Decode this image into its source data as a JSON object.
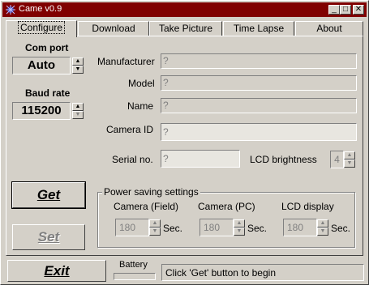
{
  "window": {
    "title": "Came v0.9",
    "controls": {
      "minimize": "_",
      "maximize": "□",
      "close": "✕"
    }
  },
  "tabs": [
    {
      "label": "Configure",
      "active": true
    },
    {
      "label": "Download",
      "active": false
    },
    {
      "label": "Take Picture",
      "active": false
    },
    {
      "label": "Time Lapse",
      "active": false
    },
    {
      "label": "About",
      "active": false
    }
  ],
  "left": {
    "com_port_label": "Com port",
    "com_port_value": "Auto",
    "baud_rate_label": "Baud rate",
    "baud_rate_value": "115200",
    "get_button": "Get",
    "set_button": "Set"
  },
  "info": {
    "manufacturer_label": "Manufacturer",
    "manufacturer_value": "?",
    "model_label": "Model",
    "model_value": "?",
    "name_label": "Name",
    "name_value": "?",
    "camera_id_label": "Camera ID",
    "camera_id_value": "?",
    "serial_label": "Serial no.",
    "serial_value": "?",
    "lcd_brightness_label": "LCD brightness",
    "lcd_brightness_value": "4"
  },
  "power": {
    "group_title": "Power saving settings",
    "field_label": "Camera (Field)",
    "field_value": "180",
    "pc_label": "Camera (PC)",
    "pc_value": "180",
    "lcd_label": "LCD display",
    "lcd_value": "180",
    "unit": "Sec."
  },
  "bottom": {
    "exit_button": "Exit",
    "battery_label": "Battery",
    "status_text": "Click 'Get' button to begin"
  }
}
